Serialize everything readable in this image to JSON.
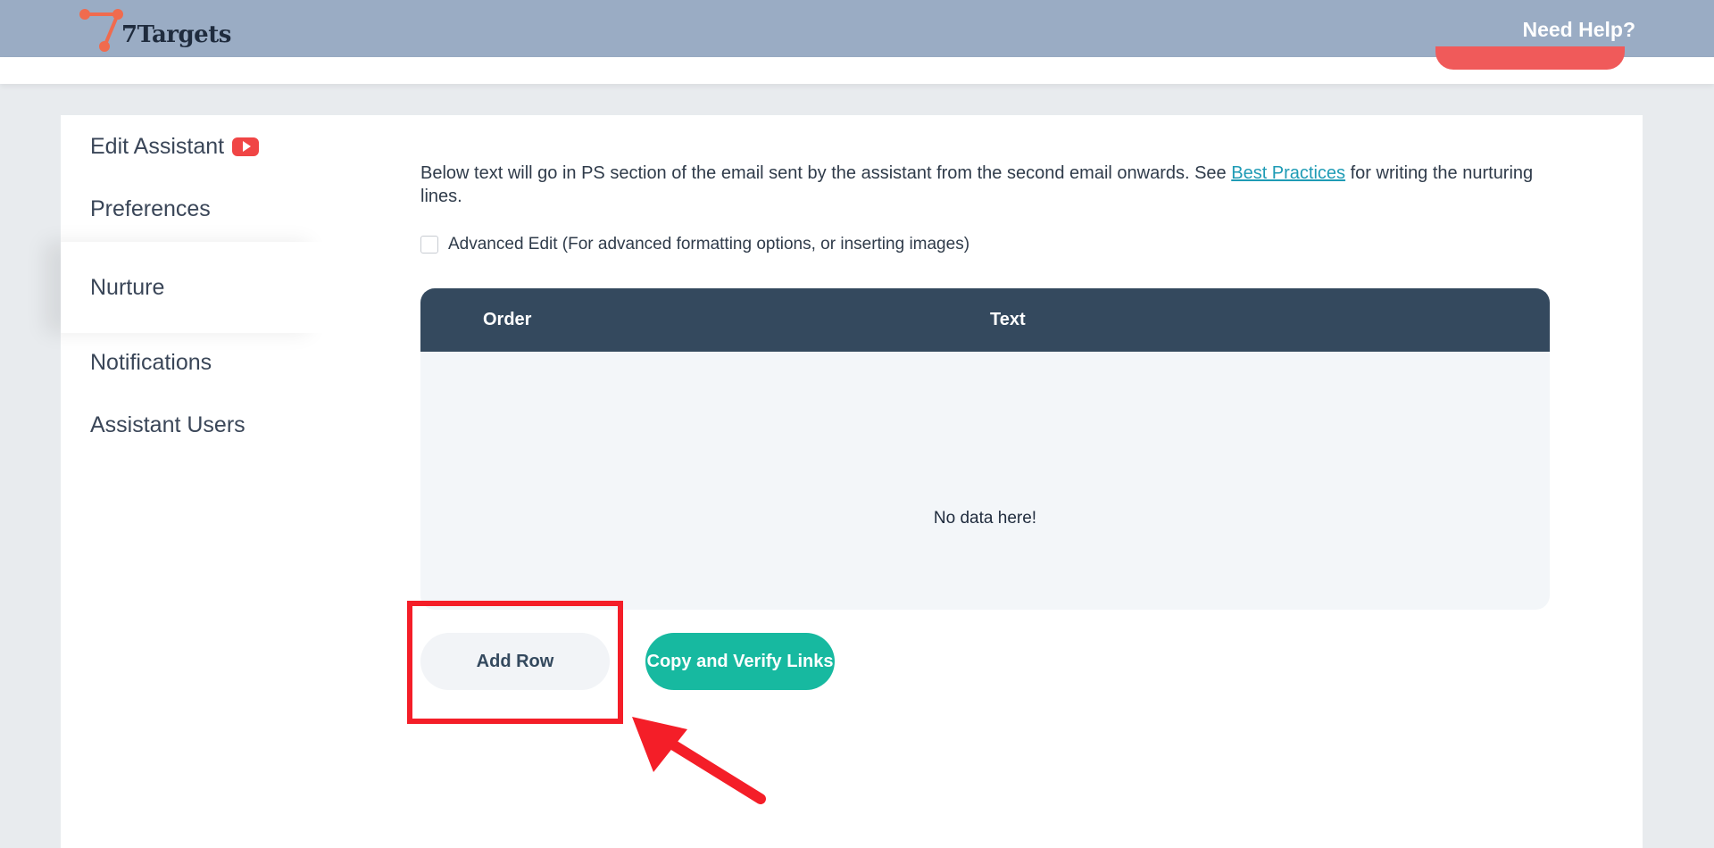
{
  "header": {
    "logo_text": "7Targets",
    "help_label": "Need Help?",
    "accent_color": "#f05a5a",
    "bar_color": "#9aacc4"
  },
  "sidebar": {
    "items": [
      {
        "label": "Edit Assistant",
        "icon": "youtube-icon"
      },
      {
        "label": "Preferences"
      },
      {
        "label": "Nurture",
        "active": true
      },
      {
        "label": "Notifications"
      },
      {
        "label": "Assistant Users"
      }
    ]
  },
  "main": {
    "description_before": "Below text will go in PS section of the email sent by the assistant from the second email onwards. See ",
    "description_link": "Best Practices",
    "description_after": " for writing the nurturing lines.",
    "advanced_edit_label": "Advanced Edit (For advanced formatting options, or inserting images)",
    "advanced_edit_checked": false,
    "table": {
      "columns": [
        "Order",
        "Text"
      ],
      "rows": [],
      "empty_message": "No data here!"
    },
    "add_row_label": "Add Row",
    "copy_verify_label": "Copy and Verify Links"
  },
  "annotation": {
    "color": "#f41e28",
    "highlight_target": "add-row-button"
  }
}
